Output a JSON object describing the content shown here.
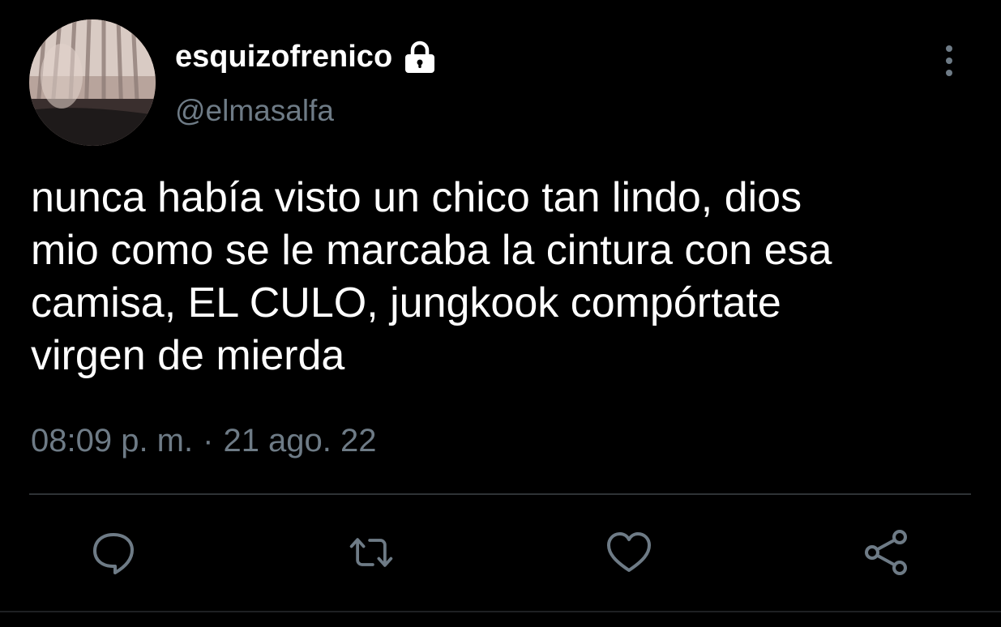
{
  "tweet": {
    "display_name": "esquizofrenico",
    "handle": "@elmasalfa",
    "protected": true,
    "text": "nunca había visto un chico tan lindo, dios\nmio como se le marcaba la cintura con esa\ncamisa, EL CULO, jungkook compórtate\nvirgen de mierda",
    "time": "08:09 p. m.",
    "separator": "·",
    "date": "21 ago. 22"
  },
  "icons": {
    "lock": "lock-icon",
    "more": "more-vertical-icon",
    "reply": "reply-icon",
    "retweet": "retweet-icon",
    "like": "heart-icon",
    "share": "share-icon"
  },
  "colors": {
    "background": "#000000",
    "text": "#ffffff",
    "muted": "#6e7b86",
    "divider": "#2f3336"
  }
}
